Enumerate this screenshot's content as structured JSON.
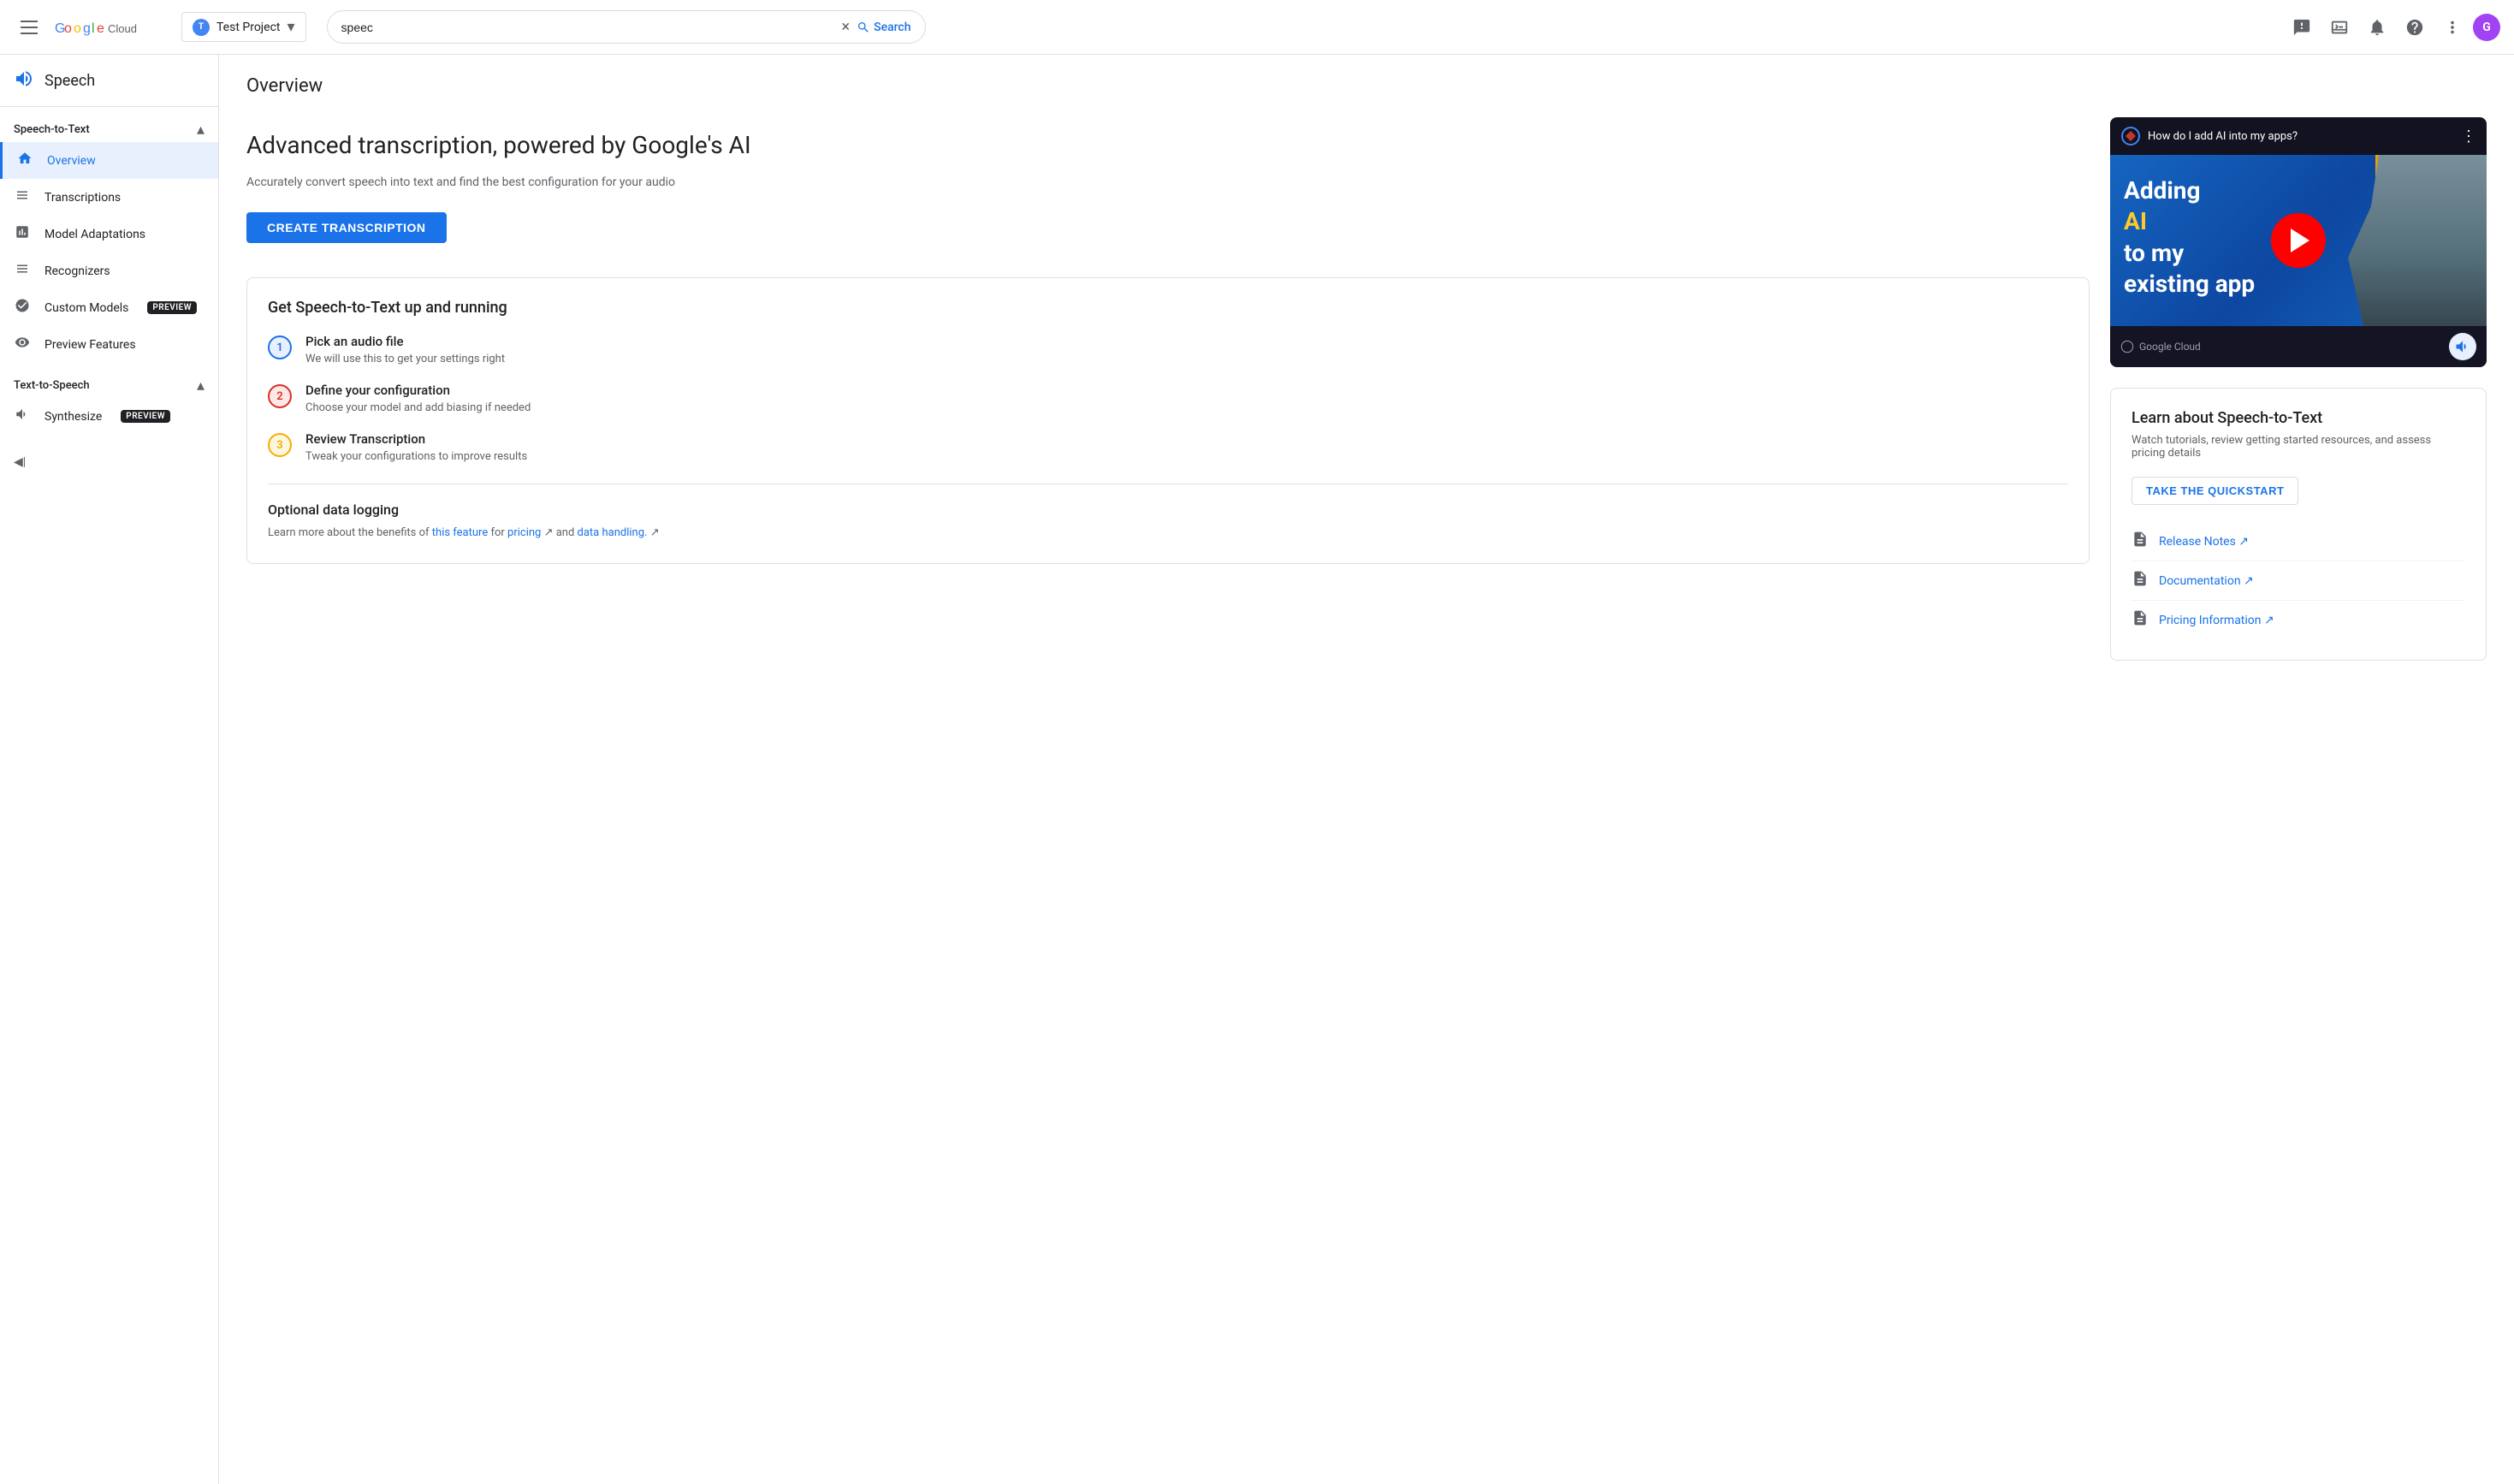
{
  "topNav": {
    "hamburger_label": "Menu",
    "logo_text": "Google Cloud",
    "project": {
      "name": "Test Project",
      "dot_label": "T"
    },
    "search": {
      "value": "speec",
      "placeholder": "Search",
      "clear_label": "×",
      "search_label": "Search"
    },
    "icons": {
      "feedback": "feedback-icon",
      "terminal": "terminal-icon",
      "notifications": "notifications-icon",
      "help": "help-icon",
      "more": "more-icon",
      "avatar": "G"
    }
  },
  "sidebar": {
    "app_icon": "🎙",
    "app_name": "Speech",
    "sections": [
      {
        "label": "Speech-to-Text",
        "collapsed": false,
        "items": [
          {
            "id": "overview",
            "label": "Overview",
            "active": true,
            "preview": false
          },
          {
            "id": "transcriptions",
            "label": "Transcriptions",
            "active": false,
            "preview": false
          },
          {
            "id": "model-adaptations",
            "label": "Model Adaptations",
            "active": false,
            "preview": false
          },
          {
            "id": "recognizers",
            "label": "Recognizers",
            "active": false,
            "preview": false
          },
          {
            "id": "custom-models",
            "label": "Custom Models",
            "active": false,
            "preview": true
          },
          {
            "id": "preview-features",
            "label": "Preview Features",
            "active": false,
            "preview": false
          }
        ]
      },
      {
        "label": "Text-to-Speech",
        "collapsed": false,
        "items": [
          {
            "id": "synthesize",
            "label": "Synthesize",
            "active": false,
            "preview": true
          }
        ]
      }
    ],
    "collapse_label": "◀|"
  },
  "mainContent": {
    "page_title": "Overview",
    "hero": {
      "title": "Advanced transcription, powered by Google's AI",
      "subtitle": "Accurately convert speech into text and find the best configuration for your audio",
      "create_button": "CREATE TRANSCRIPTION"
    },
    "gettingStarted": {
      "title": "Get Speech-to-Text up and running",
      "steps": [
        {
          "number": "1",
          "title": "Pick an audio file",
          "description": "We will use this to get your settings right",
          "color": "blue"
        },
        {
          "number": "2",
          "title": "Define your configuration",
          "description": "Choose your model and add biasing if needed",
          "color": "red"
        },
        {
          "number": "3",
          "title": "Review Transcription",
          "description": "Tweak your configurations to improve results",
          "color": "yellow"
        }
      ],
      "optional": {
        "title": "Optional data logging",
        "description_start": "Learn more about the benefits of ",
        "link1_text": "this feature",
        "description_middle": " for ",
        "link2_text": "pricing",
        "description_end2": " and ",
        "link3_text": "data handling.",
        "description_end": ""
      }
    },
    "video": {
      "header_text": "How do I add AI into my apps?",
      "title_line1": "Adding",
      "title_ai": "AI",
      "title_line2": "to my",
      "title_line3": "existing app",
      "footer_brand": "Google Cloud"
    },
    "learn": {
      "title": "Learn about Speech-to-Text",
      "subtitle": "Watch tutorials, review getting started resources, and assess pricing details",
      "quickstart_label": "TAKE THE QUICKSTART",
      "resources": [
        {
          "id": "release-notes",
          "label": "Release Notes ↗"
        },
        {
          "id": "documentation",
          "label": "Documentation ↗"
        },
        {
          "id": "pricing-information",
          "label": "Pricing Information ↗"
        }
      ]
    }
  }
}
